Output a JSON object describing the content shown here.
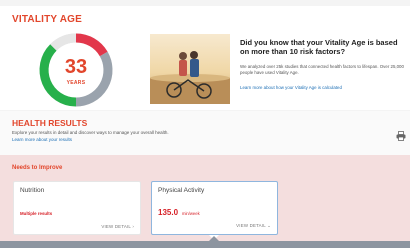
{
  "vitality_age": {
    "title": "VITALITY AGE",
    "age": "33",
    "age_unit": "YEARS",
    "gauge_percent": 72,
    "colors": {
      "green": "#27b04b",
      "red": "#e2374b",
      "gray": "#9aa3ad"
    },
    "headline": "Did you know that your Vitality Age is based on more than 10 risk factors?",
    "body": "We analyzed over 25k studies that connected health factors to lifespan. Over 25,000 people have used Vitality Age.",
    "link": "Learn more about how your Vitality Age is calculated"
  },
  "health_results": {
    "title": "HEALTH RESULTS",
    "description": "Explore your results in detail and discover ways to manage your overall health.",
    "link": "Learn more about your results"
  },
  "needs_to_improve": {
    "title": "Needs to Improve",
    "cards": [
      {
        "title": "Nutrition",
        "value": "Multiple results",
        "view_detail": "VIEW DETAIL"
      },
      {
        "title": "Physical Activity",
        "value_number": "135.0",
        "value_unit": "min/week",
        "view_detail": "VIEW DETAIL"
      }
    ]
  },
  "icons": {
    "print": "printer-icon",
    "chevron_right": "chevron-right-icon",
    "chevron_down": "chevron-down-icon"
  }
}
